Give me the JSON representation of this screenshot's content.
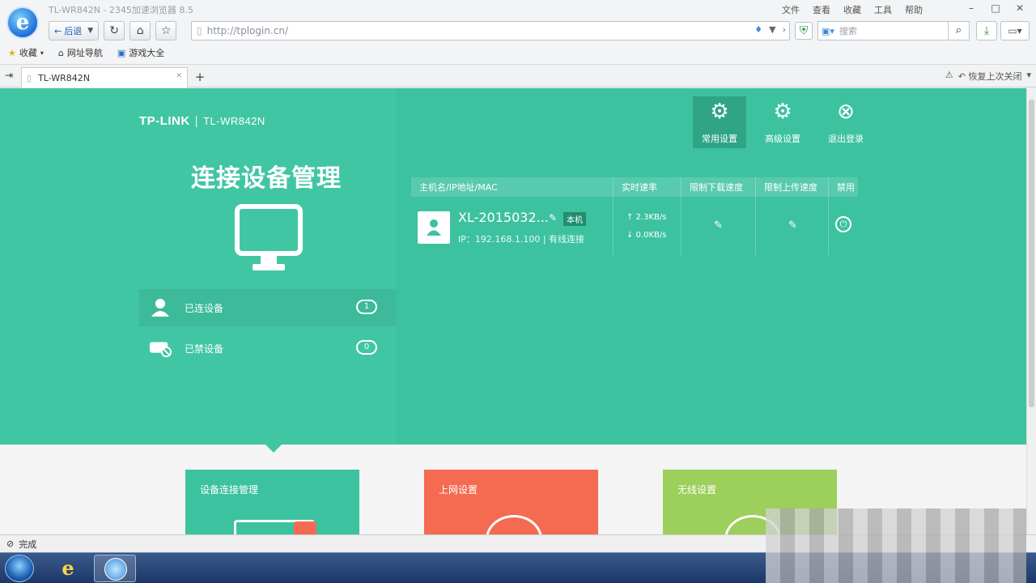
{
  "browser": {
    "window_title": "TL-WR842N - 2345加速浏览器 8.5",
    "top_menu": [
      "文件",
      "查看",
      "收藏",
      "工具",
      "帮助"
    ],
    "back_label": "后退",
    "url": "http://tplogin.cn/",
    "search_placeholder": "搜索",
    "bookmarks": [
      "收藏",
      "网址导航",
      "游戏大全"
    ],
    "tab_title": "TL-WR842N",
    "restore_label": "恢复上次关闭",
    "status_text": "完成"
  },
  "router": {
    "brand": "TP-LINK",
    "model": "TL-WR842N",
    "page_title": "连接设备管理",
    "sidebar": [
      {
        "label": "已连设备",
        "count": "1"
      },
      {
        "label": "已禁设备",
        "count": "0"
      }
    ],
    "actions": [
      {
        "label": "常用设置"
      },
      {
        "label": "高级设置"
      },
      {
        "label": "退出登录"
      }
    ],
    "table": {
      "headers": [
        "主机名/IP地址/MAC",
        "实时速率",
        "限制下载速度",
        "限制上传速度",
        "禁用"
      ],
      "rows": [
        {
          "name": "XL-2015032...",
          "tag": "本机",
          "info": "IP：192.168.1.100 | 有线连接",
          "up": "↑ 2.3KB/s",
          "down": "↓ 0.0KB/s"
        }
      ]
    },
    "cards": [
      {
        "title": "设备连接管理",
        "color": "#3dc2a0"
      },
      {
        "title": "上网设置",
        "color": "#f46b51"
      },
      {
        "title": "无线设置",
        "color": "#9ccf5b"
      }
    ]
  }
}
